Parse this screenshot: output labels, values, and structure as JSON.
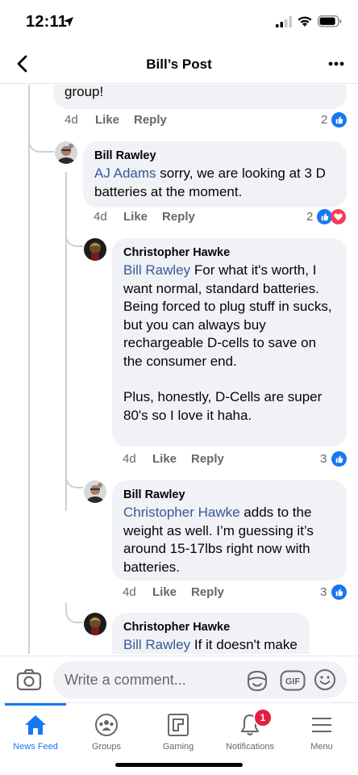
{
  "status_bar": {
    "time": "12:11"
  },
  "nav": {
    "title": "Bill’s Post"
  },
  "comments": [
    {
      "text": "group!",
      "time": "4d",
      "like": "Like",
      "reply": "Reply",
      "reaction_count": "2",
      "reactions": [
        "like"
      ]
    },
    {
      "author": "Bill Rawley",
      "mention": "AJ Adams",
      "text": "  sorry, we are looking at 3 D batteries at the moment.",
      "time": "4d",
      "like": "Like",
      "reply": "Reply",
      "reaction_count": "2",
      "reactions": [
        "like",
        "love"
      ]
    },
    {
      "author": "Christopher Hawke",
      "mention": "Bill Rawley",
      "text": " For what it's worth, I want normal, standard batteries. Being forced to plug stuff in sucks, but you can always buy rechargeable D-cells to save on the consumer end.",
      "text2": "Plus, honestly, D-Cells are super 80's so I love it haha.",
      "time": "4d",
      "like": "Like",
      "reply": "Reply",
      "reaction_count": "3",
      "reactions": [
        "like"
      ]
    },
    {
      "author": "Bill Rawley",
      "mention": "Christopher Hawke",
      "text": "  adds to the weight as well. I’m guessing it’s around 15-17lbs right now with batteries.",
      "time": "4d",
      "like": "Like",
      "reply": "Reply",
      "reaction_count": "3",
      "reactions": [
        "like"
      ]
    },
    {
      "author": "Christopher Hawke",
      "mention": "Bill Rawley",
      "text": " If it doesn't make"
    }
  ],
  "comment_bar": {
    "placeholder": "Write a comment..."
  },
  "tabs": [
    {
      "label": "News Feed",
      "icon": "home-icon",
      "active": true
    },
    {
      "label": "Groups",
      "icon": "groups-icon"
    },
    {
      "label": "Gaming",
      "icon": "gaming-icon"
    },
    {
      "label": "Notifications",
      "icon": "bell-icon",
      "badge": "1"
    },
    {
      "label": "Menu",
      "icon": "menu-icon"
    }
  ],
  "colors": {
    "accent": "#1877f2",
    "mention": "#385898",
    "bubble": "#f0f2f5",
    "love": "#f33e58",
    "badge": "#e41e3f"
  }
}
